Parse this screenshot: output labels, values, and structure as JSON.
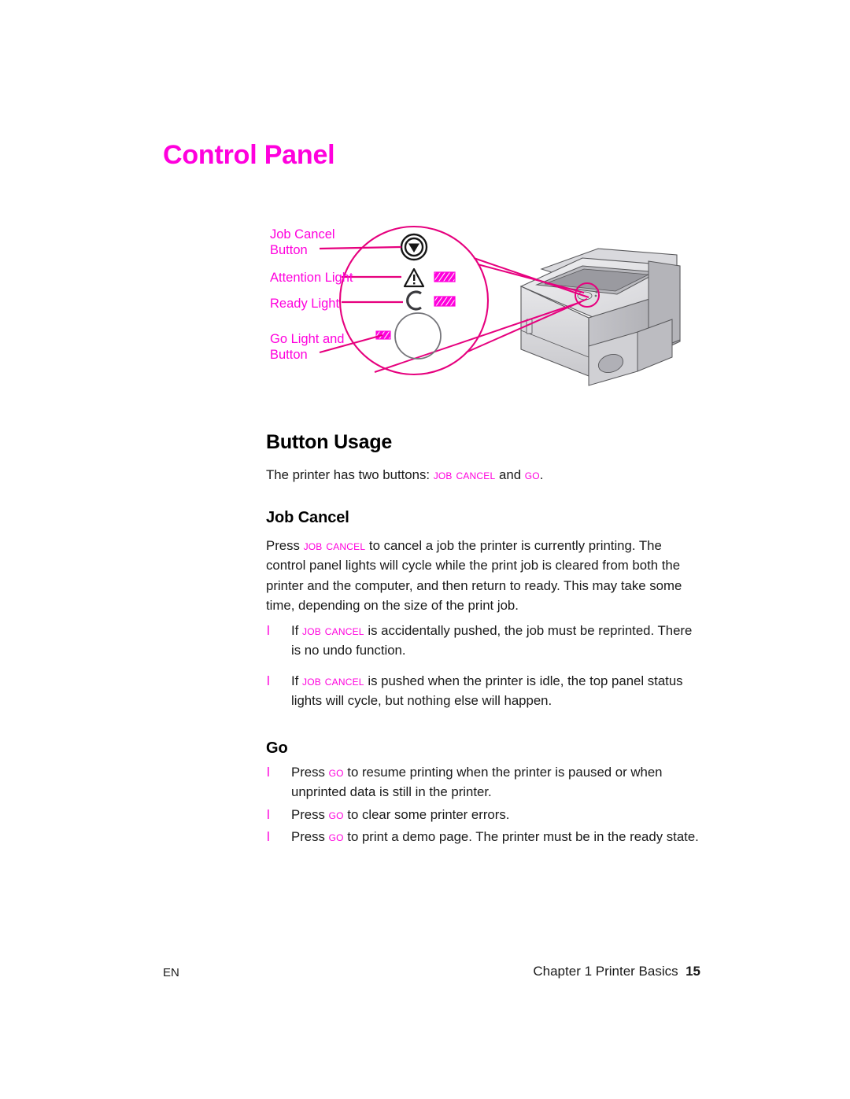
{
  "page": {
    "title": "Control Panel"
  },
  "figure": {
    "name": "printer-control-panel-diagram",
    "callouts": [
      {
        "id": "job-cancel-button",
        "label": "Job Cancel\nButton"
      },
      {
        "id": "attention-light",
        "label": "Attention Light"
      },
      {
        "id": "ready-light",
        "label": "Ready Light"
      },
      {
        "id": "go-light-and-button",
        "label": "Go Light and\nButton"
      }
    ],
    "icons": [
      {
        "name": "job-cancel-icon",
        "desc": "circle with downward triangle"
      },
      {
        "name": "attention-triangle-icon",
        "desc": "warning triangle with exclamation"
      },
      {
        "name": "ready-arc-icon",
        "desc": "open circular arc"
      },
      {
        "name": "go-button-circle",
        "desc": "large round push button"
      }
    ],
    "colors": {
      "accent": "#ff00dd",
      "printer_light": "#e8e8ea",
      "printer_mid": "#cfcfd2",
      "printer_dark": "#a8a8ac",
      "outline": "#58585b"
    }
  },
  "sections": {
    "button_usage": {
      "heading": "Button Usage",
      "intro_before": "The printer has two buttons: ",
      "intro_kw1": "Job Cancel",
      "intro_mid": " and ",
      "intro_kw2": "Go",
      "intro_after": "."
    },
    "job_cancel": {
      "heading": "Job Cancel",
      "para_before": "Press ",
      "para_kw": "Job Cancel",
      "para_after": " to cancel a job the printer is currently printing. The control panel lights will cycle while the print job is cleared from both the printer and the computer, and then return to ready. This may take some time, depending on the size of the print job.",
      "bullets": [
        {
          "marker": "l",
          "before": "If ",
          "kw": "Job Cancel",
          "after": " is accidentally pushed, the job must be reprinted. There is no undo function."
        },
        {
          "marker": "l",
          "before": "If ",
          "kw": "Job Cancel",
          "after": " is pushed when the printer is idle, the top panel status lights will cycle, but nothing else will happen."
        }
      ]
    },
    "go": {
      "heading": "Go",
      "bullets": [
        {
          "marker": "l",
          "before": "Press ",
          "kw": "Go",
          "after": " to resume printing when the printer is paused or when unprinted data is still in the printer."
        },
        {
          "marker": "l",
          "before": "Press ",
          "kw": "Go",
          "after": " to clear some printer errors."
        },
        {
          "marker": "l",
          "before": "Press ",
          "kw": "Go",
          "after": " to print a demo page. The printer must be in the ready state."
        }
      ]
    }
  },
  "footer": {
    "language": "EN",
    "chapter": "Chapter 1 Printer Basics",
    "page_number": "15"
  }
}
